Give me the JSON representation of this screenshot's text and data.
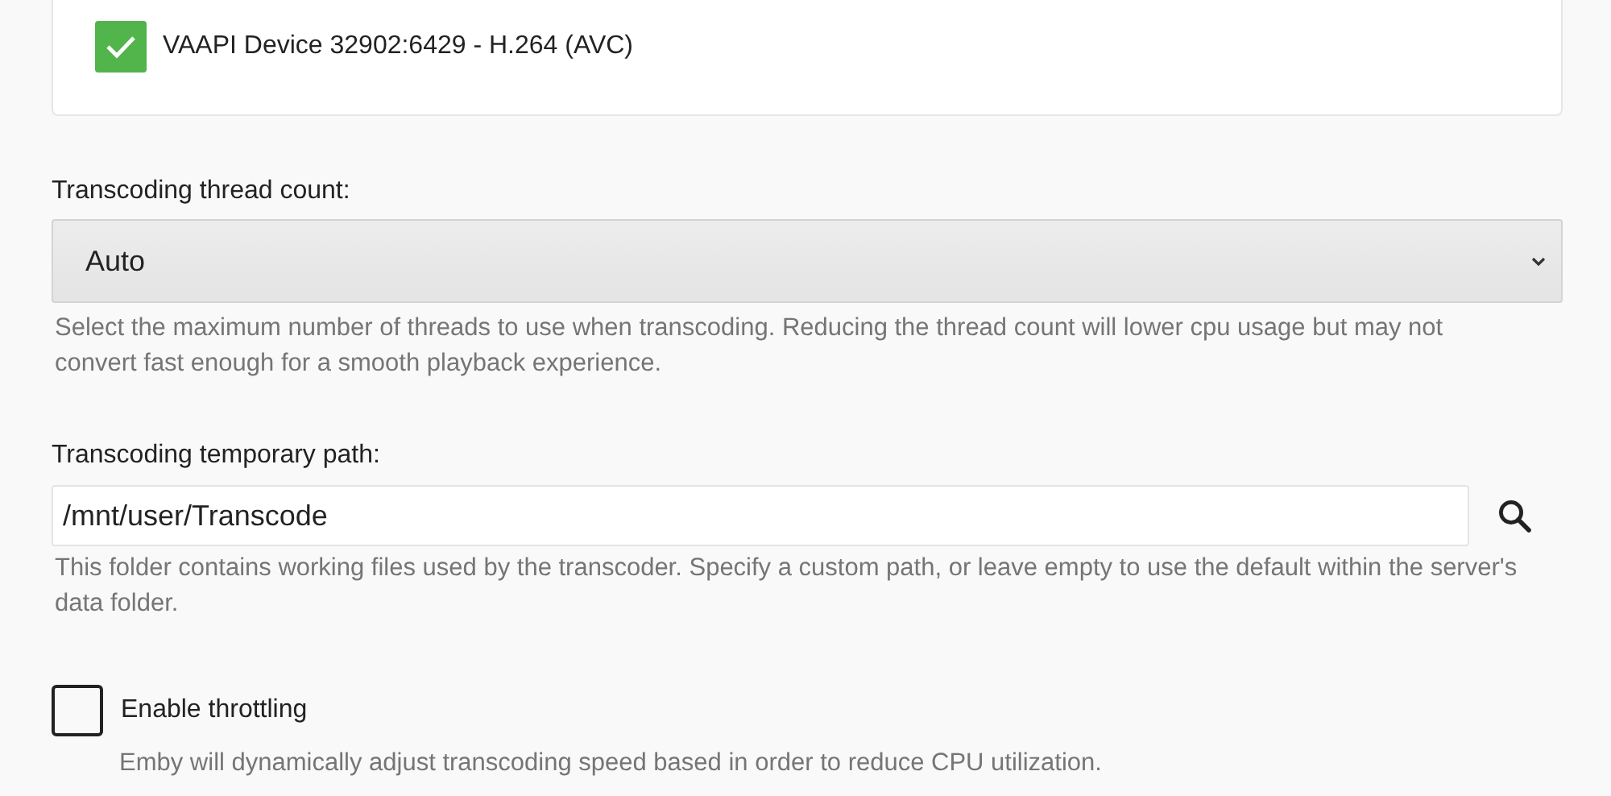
{
  "devices": [
    {
      "label": "VAAPI Device 32902:6429 - H.264 (AVC)",
      "checked": true
    }
  ],
  "thread_count": {
    "label": "Transcoding thread count:",
    "value": "Auto",
    "help": "Select the maximum number of threads to use when transcoding. Reducing the thread count will lower cpu usage but may not convert fast enough for a smooth playback experience."
  },
  "temp_path": {
    "label": "Transcoding temporary path:",
    "value": "/mnt/user/Transcode",
    "help": "This folder contains working files used by the transcoder. Specify a custom path, or leave empty to use the default within the server's data folder."
  },
  "throttling": {
    "label": "Enable throttling",
    "checked": false,
    "help": "Emby will dynamically adjust transcoding speed based in order to reduce CPU utilization."
  }
}
